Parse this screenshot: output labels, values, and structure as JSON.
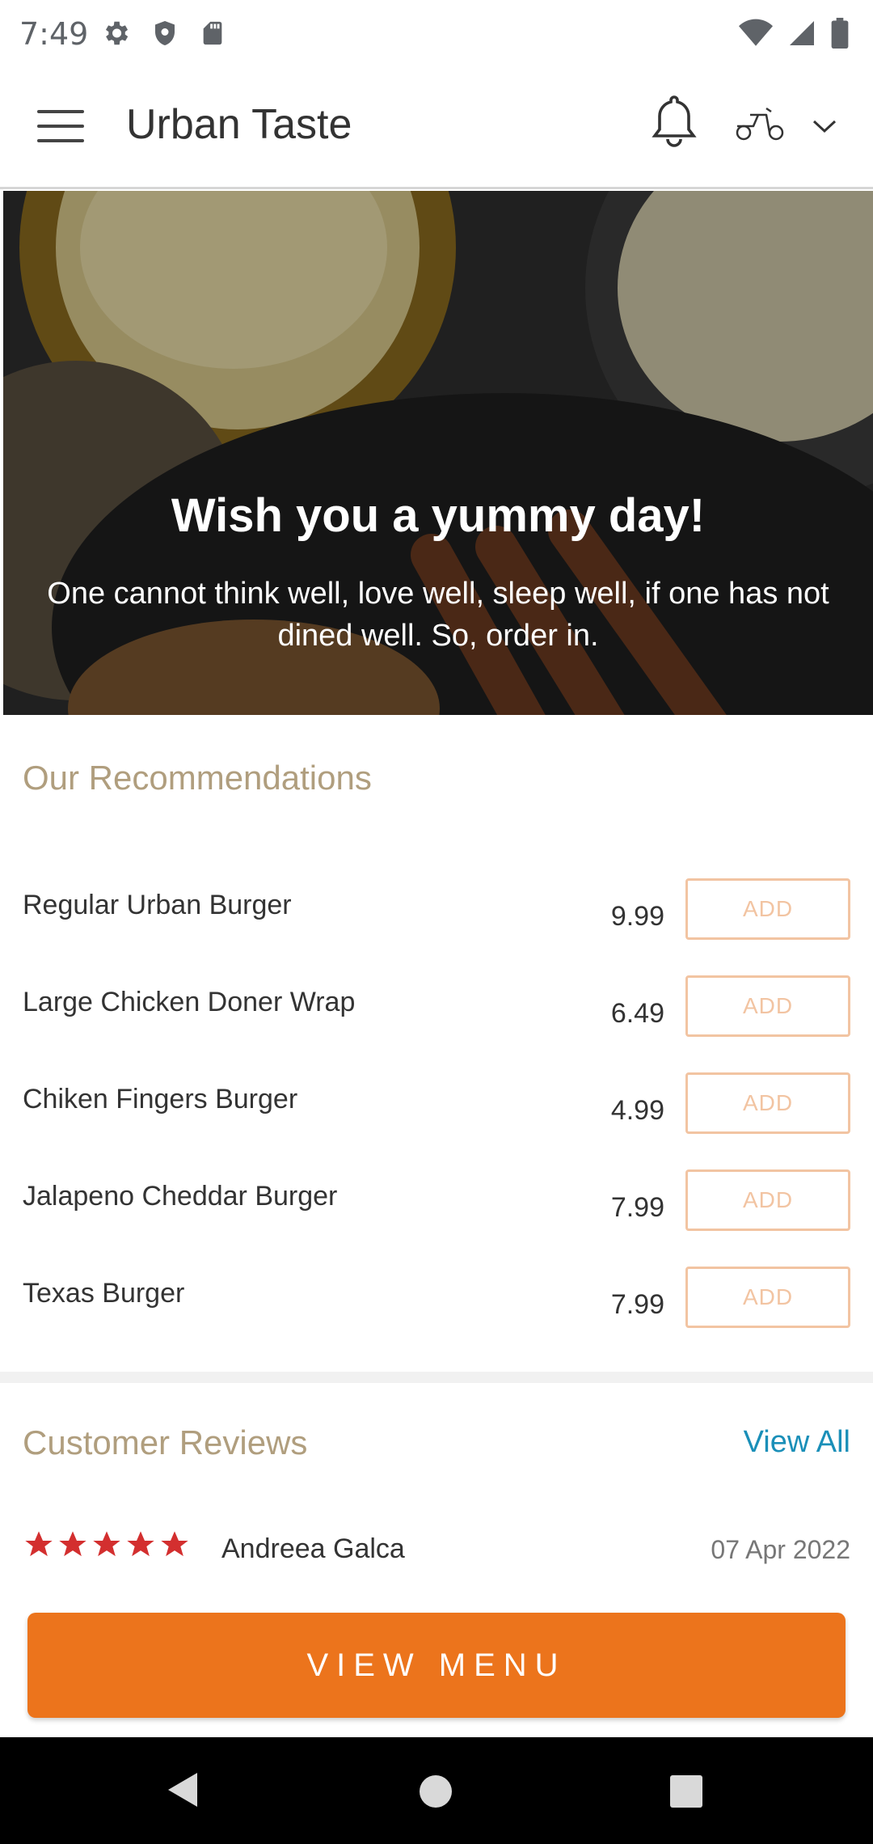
{
  "status_bar": {
    "time": "7:49",
    "left_icons": [
      "settings-icon",
      "shield-icon",
      "sd-card-icon"
    ],
    "right_icons": [
      "wifi-icon",
      "signal-icon",
      "battery-icon"
    ]
  },
  "app_bar": {
    "title": "Urban Taste",
    "icons": [
      "menu-icon",
      "bell-icon",
      "delivery-scooter-icon",
      "chevron-down-icon"
    ]
  },
  "hero": {
    "title": "Wish you a yummy day!",
    "subtitle": "One cannot think well, love well, sleep well, if one has not dined well. So, order in."
  },
  "recommendations": {
    "title": "Our Recommendations",
    "add_label": "ADD",
    "items": [
      {
        "name": "Regular Urban Burger",
        "price": "9.99"
      },
      {
        "name": "Large Chicken Doner Wrap",
        "price": "6.49"
      },
      {
        "name": "Chiken Fingers Burger",
        "price": "4.99"
      },
      {
        "name": "Jalapeno Cheddar Burger",
        "price": "7.99"
      },
      {
        "name": "Texas Burger",
        "price": "7.99"
      }
    ]
  },
  "reviews": {
    "title": "Customer Reviews",
    "view_all": "View All",
    "items": [
      {
        "rating": 5,
        "name": "Andreea Galca",
        "date": "07 Apr 2022"
      }
    ]
  },
  "cta": {
    "label": "VIEW MENU"
  },
  "colors": {
    "accent": "#ec741c",
    "section_title": "#b09e7e",
    "link": "#1a8fb8",
    "add_button": "#f2c4a2",
    "star": "#d32f2f"
  }
}
